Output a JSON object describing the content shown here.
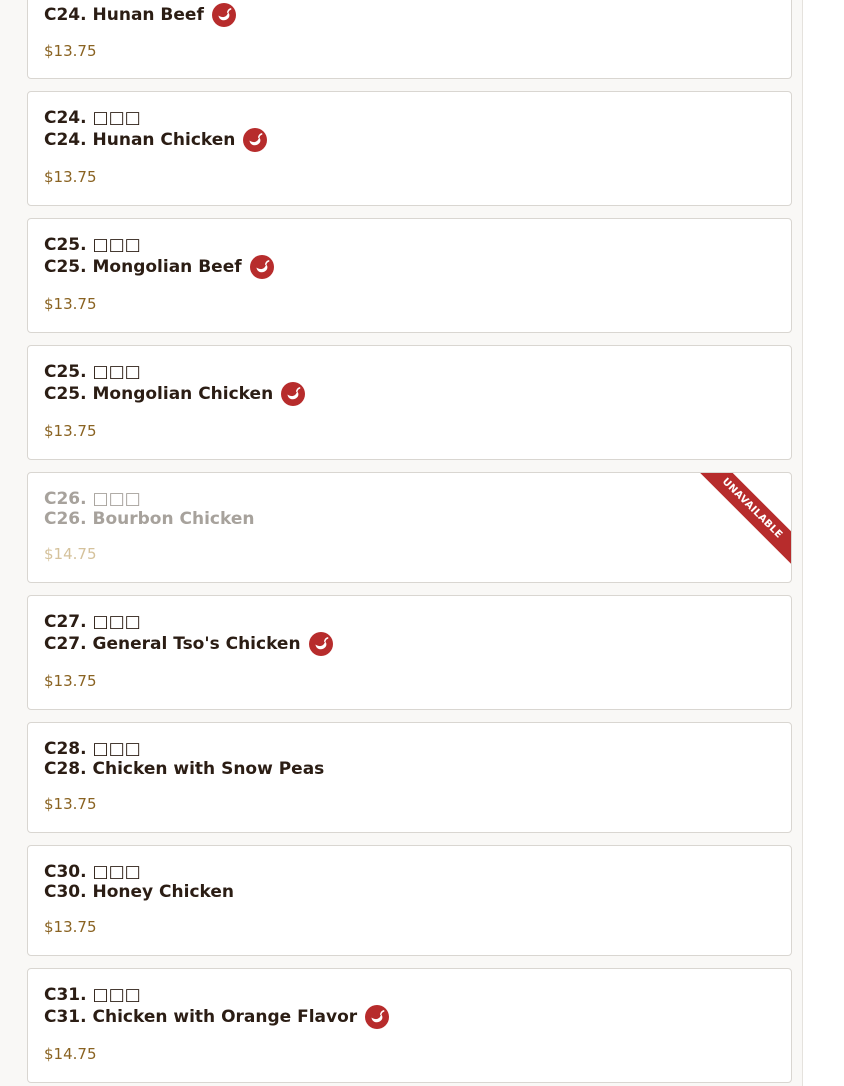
{
  "menu": {
    "items": [
      {
        "code_cn": "",
        "name": "C24. Hunan Beef",
        "price": "$13.75",
        "spicy": true,
        "unavailable": false
      },
      {
        "code_cn": "C24. □□□",
        "name": "C24. Hunan Chicken",
        "price": "$13.75",
        "spicy": true,
        "unavailable": false
      },
      {
        "code_cn": "C25. □□□",
        "name": "C25. Mongolian Beef",
        "price": "$13.75",
        "spicy": true,
        "unavailable": false
      },
      {
        "code_cn": "C25. □□□",
        "name": "C25. Mongolian Chicken",
        "price": "$13.75",
        "spicy": true,
        "unavailable": false
      },
      {
        "code_cn": "C26. □□□",
        "name": "C26. Bourbon Chicken",
        "price": "$14.75",
        "spicy": false,
        "unavailable": true,
        "ribbon": "UNAVAILABLE"
      },
      {
        "code_cn": "C27. □□□",
        "name": "C27. General Tso's Chicken",
        "price": "$13.75",
        "spicy": true,
        "unavailable": false
      },
      {
        "code_cn": "C28. □□□",
        "name": "C28. Chicken with Snow Peas",
        "price": "$13.75",
        "spicy": false,
        "unavailable": false
      },
      {
        "code_cn": "C30. □□□",
        "name": "C30. Honey Chicken",
        "price": "$13.75",
        "spicy": false,
        "unavailable": false
      },
      {
        "code_cn": "C31. □□□",
        "name": "C31. Chicken with Orange Flavor",
        "price": "$14.75",
        "spicy": true,
        "unavailable": false
      }
    ]
  },
  "icons": {
    "spicy": "chili-pepper-icon"
  },
  "colors": {
    "spicy_icon": "#b72c2c",
    "price": "#8a6322",
    "unavailable_ribbon": "#b72c2c",
    "title": "#2b1d14"
  }
}
